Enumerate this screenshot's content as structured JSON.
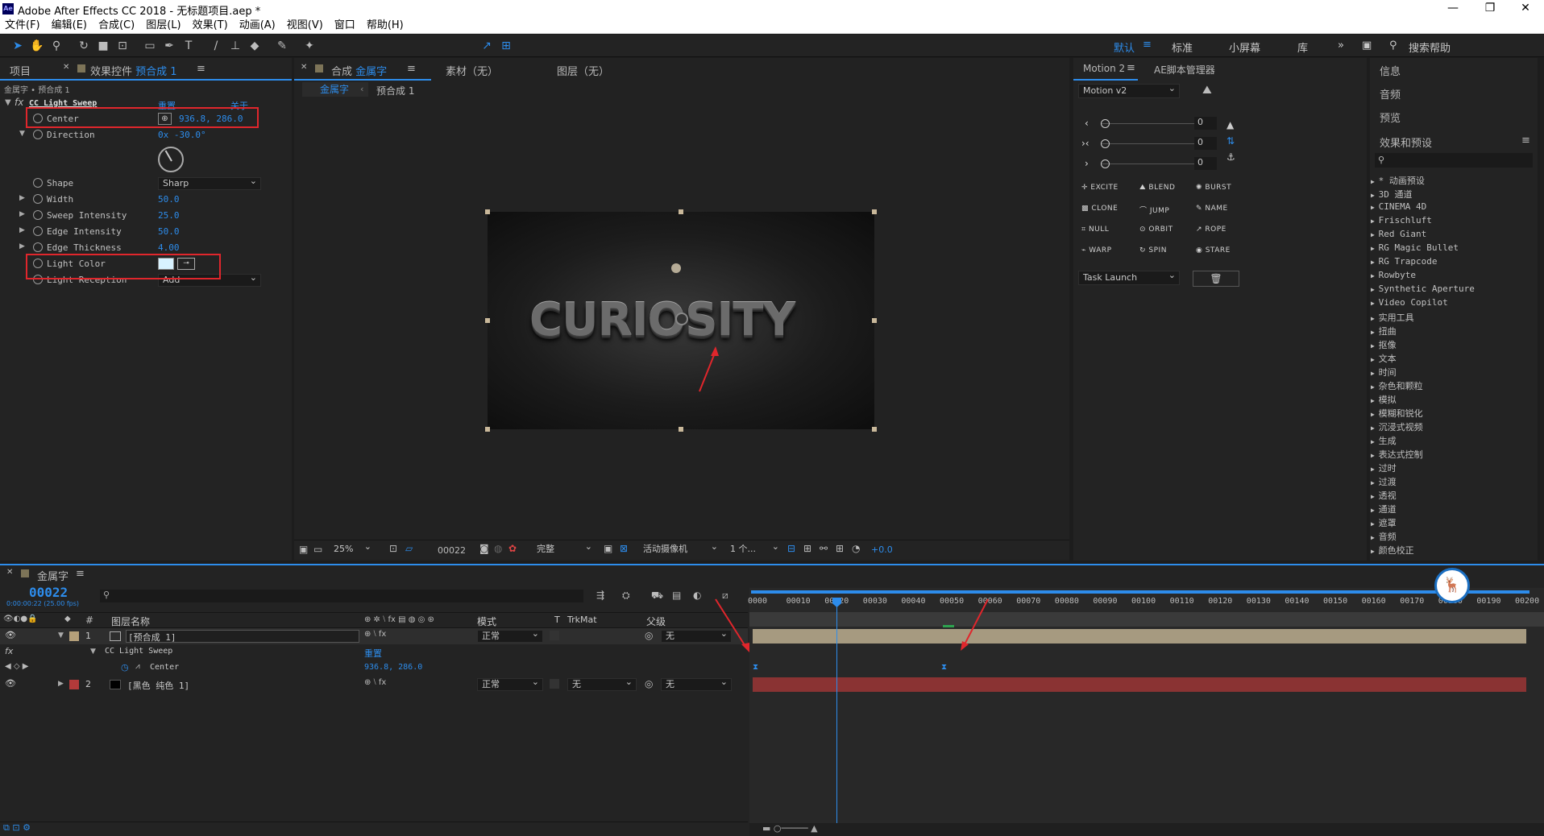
{
  "window": {
    "title": "Adobe After Effects CC 2018 - 无标题项目.aep *",
    "logo": "Ae"
  },
  "menu": [
    "文件(F)",
    "编辑(E)",
    "合成(C)",
    "图层(L)",
    "效果(T)",
    "动画(A)",
    "视图(V)",
    "窗口",
    "帮助(H)"
  ],
  "toolbar": {
    "align_label": "对齐"
  },
  "workspaces": [
    "默认",
    "标准",
    "小屏幕",
    "库"
  ],
  "search_help": "搜索帮助",
  "left_panel": {
    "tab_project": "项目",
    "tab_effects": "效果控件",
    "tab_effects_target": "预合成 1",
    "breadcrumb": "金属字 • 预合成 1",
    "effect_name": "CC Light Sweep",
    "reset": "重置",
    "about": "关于...",
    "props": [
      {
        "name": "Center",
        "value": "936.8, 286.0"
      },
      {
        "name": "Direction",
        "value": "0x -30.0°"
      },
      {
        "name": "Shape",
        "value": "Sharp"
      },
      {
        "name": "Width",
        "value": "50.0"
      },
      {
        "name": "Sweep Intensity",
        "value": "25.0"
      },
      {
        "name": "Edge Intensity",
        "value": "50.0"
      },
      {
        "name": "Edge Thickness",
        "value": "4.00"
      },
      {
        "name": "Light Color",
        "value": ""
      },
      {
        "name": "Light Reception",
        "value": "Add"
      }
    ]
  },
  "comp_panel": {
    "tab_comp_prefix": "合成",
    "tab_comp_name": "金属字",
    "tab_footage": "素材（无）",
    "tab_layer": "图层（无）",
    "sub_tabs": [
      "金属字",
      "预合成 1"
    ],
    "artwork_text": "CURIOSITY",
    "bottom": {
      "zoom": "25%",
      "timecode": "00022",
      "quality": "完整",
      "camera": "活动摄像机",
      "views": "1 个...",
      "exposure": "+0.0"
    }
  },
  "motion_panel": {
    "tab": "Motion 2",
    "tab2": "AE脚本管理器",
    "preset": "Motion v2",
    "slider_values": [
      "0",
      "0",
      "0"
    ],
    "buttons": [
      "EXCITE",
      "BLEND",
      "BURST",
      "CLONE",
      "JUMP",
      "NAME",
      "NULL",
      "ORBIT",
      "ROPE",
      "WARP",
      "SPIN",
      "STARE"
    ],
    "task": "Task Launch"
  },
  "right_panel": {
    "items": [
      "信息",
      "音频",
      "预览"
    ],
    "effects_title": "效果和预设",
    "categories": [
      "* 动画预设",
      "3D 通道",
      "CINEMA 4D",
      "Frischluft",
      "Red Giant",
      "RG Magic Bullet",
      "RG Trapcode",
      "Rowbyte",
      "Synthetic Aperture",
      "Video Copilot",
      "实用工具",
      "扭曲",
      "抠像",
      "文本",
      "时间",
      "杂色和颗粒",
      "模拟",
      "模糊和锐化",
      "沉浸式视频",
      "生成",
      "表达式控制",
      "过时",
      "过渡",
      "透视",
      "通道",
      "遮罩",
      "音频",
      "颜色校正"
    ]
  },
  "timeline": {
    "comp_name": "金属字",
    "timecode": "00022",
    "timecode_sub": "0:00:00:22 (25.00 fps)",
    "cols": {
      "layer_name": "图层名称",
      "mode": "模式",
      "trkmat": "TrkMat",
      "parent": "父级"
    },
    "ruler": [
      "0000",
      "00010",
      "00020",
      "00030",
      "00040",
      "00050",
      "00060",
      "00070",
      "00080",
      "00090",
      "00100",
      "00110",
      "00120",
      "00130",
      "00140",
      "00150",
      "00160",
      "00170",
      "00180",
      "00190",
      "00200"
    ],
    "layers": [
      {
        "num": "1",
        "name": "[预合成 1]",
        "mode": "正常",
        "parent": "无",
        "color": "#b5a07a"
      },
      {
        "num": "2",
        "name": "[黑色 纯色 1]",
        "mode": "正常",
        "trkmat": "无",
        "parent": "无",
        "color": "#b33a3a"
      }
    ],
    "effect_row": "CC Light Sweep",
    "effect_reset": "重置",
    "center_row": "Center",
    "center_value": "936.8, 286.0"
  },
  "colors": {
    "accent": "#2d8ceb",
    "highlight_box": "#e0262c",
    "layer1_bar": "#a69a80",
    "layer2_bar": "#8a3333"
  }
}
